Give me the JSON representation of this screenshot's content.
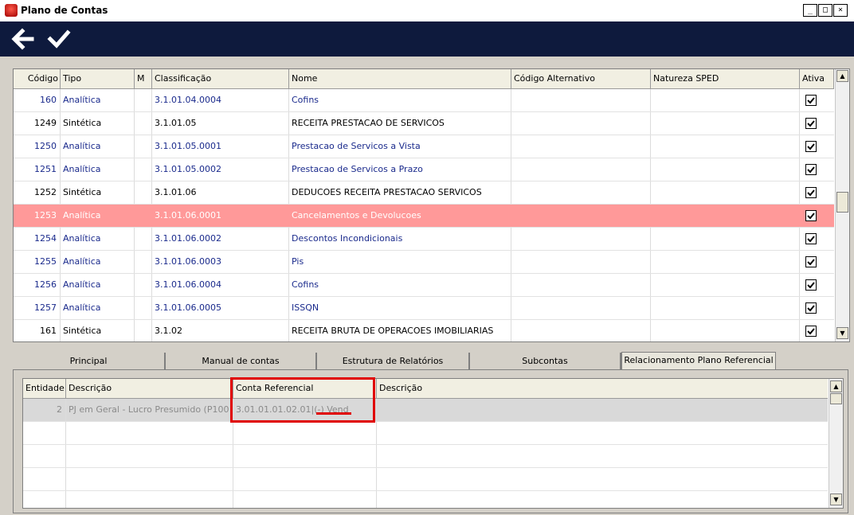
{
  "window": {
    "title": "Plano de Contas",
    "buttons": [
      "_",
      "□",
      "×"
    ]
  },
  "toolbar": {
    "back_icon": "arrow-left-icon",
    "confirm_icon": "check-icon"
  },
  "accounts_table": {
    "columns": [
      "Código",
      "Tipo",
      "M",
      "Classificação",
      "Nome",
      "Código Alternativo",
      "Natureza SPED",
      "Ativa"
    ],
    "rows": [
      {
        "codigo": "160",
        "tipo": "Analítica",
        "m": "",
        "classificacao": "3.1.01.04.0004",
        "nome": "Cofins",
        "codigo_alt": "",
        "natureza": "",
        "ativa": true,
        "style": "analitica"
      },
      {
        "codigo": "1249",
        "tipo": "Sintética",
        "m": "",
        "classificacao": "3.1.01.05",
        "nome": "RECEITA PRESTACAO DE SERVICOS",
        "codigo_alt": "",
        "natureza": "",
        "ativa": true,
        "style": "sintetica"
      },
      {
        "codigo": "1250",
        "tipo": "Analítica",
        "m": "",
        "classificacao": "3.1.01.05.0001",
        "nome": "Prestacao de Servicos a Vista",
        "codigo_alt": "",
        "natureza": "",
        "ativa": true,
        "style": "analitica"
      },
      {
        "codigo": "1251",
        "tipo": "Analítica",
        "m": "",
        "classificacao": "3.1.01.05.0002",
        "nome": "Prestacao de Servicos a Prazo",
        "codigo_alt": "",
        "natureza": "",
        "ativa": true,
        "style": "analitica"
      },
      {
        "codigo": "1252",
        "tipo": "Sintética",
        "m": "",
        "classificacao": "3.1.01.06",
        "nome": "DEDUCOES RECEITA PRESTACAO SERVICOS",
        "codigo_alt": "",
        "natureza": "",
        "ativa": true,
        "style": "sintetica"
      },
      {
        "codigo": "1253",
        "tipo": "Analítica",
        "m": "",
        "classificacao": "3.1.01.06.0001",
        "nome": "Cancelamentos e Devolucoes",
        "codigo_alt": "",
        "natureza": "",
        "ativa": true,
        "style": "selected"
      },
      {
        "codigo": "1254",
        "tipo": "Analítica",
        "m": "",
        "classificacao": "3.1.01.06.0002",
        "nome": "Descontos Incondicionais",
        "codigo_alt": "",
        "natureza": "",
        "ativa": true,
        "style": "analitica"
      },
      {
        "codigo": "1255",
        "tipo": "Analítica",
        "m": "",
        "classificacao": "3.1.01.06.0003",
        "nome": "Pis",
        "codigo_alt": "",
        "natureza": "",
        "ativa": true,
        "style": "analitica"
      },
      {
        "codigo": "1256",
        "tipo": "Analítica",
        "m": "",
        "classificacao": "3.1.01.06.0004",
        "nome": "Cofins",
        "codigo_alt": "",
        "natureza": "",
        "ativa": true,
        "style": "analitica"
      },
      {
        "codigo": "1257",
        "tipo": "Analítica",
        "m": "",
        "classificacao": "3.1.01.06.0005",
        "nome": "ISSQN",
        "codigo_alt": "",
        "natureza": "",
        "ativa": true,
        "style": "analitica"
      },
      {
        "codigo": "161",
        "tipo": "Sintética",
        "m": "",
        "classificacao": "3.1.02",
        "nome": "RECEITA BRUTA DE OPERACOES IMOBILIARIAS",
        "codigo_alt": "",
        "natureza": "",
        "ativa": true,
        "style": "sintetica"
      }
    ]
  },
  "tabs": [
    "Principal",
    "Manual de contas",
    "Estrutura de Relatórios",
    "Subcontas",
    "Relacionamento Plano Referencial"
  ],
  "active_tab": "Relacionamento Plano Referencial",
  "referencial_table": {
    "columns": [
      "Entidade",
      "Descrição",
      "Conta Referencial",
      "Descrição"
    ],
    "rows": [
      {
        "entidade": "2",
        "descricao": "PJ em Geral - Lucro Presumido (P100 -",
        "conta": "3.01.01.01.02.01",
        "descricao2": "(-) Vend"
      }
    ]
  },
  "colors": {
    "toolbar_bg": "#0e1a3d",
    "selected_row": "#ff9999",
    "link_text": "#1a2a8c",
    "highlight": "#e00000"
  }
}
